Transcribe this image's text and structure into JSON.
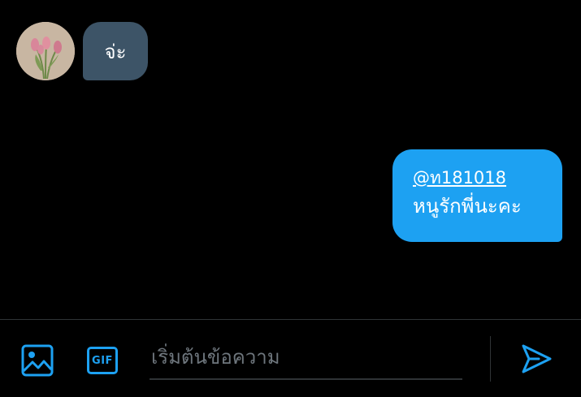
{
  "conversation": {
    "incoming": {
      "avatar_icon": "tulip-flowers-avatar",
      "text": "จ่ะ"
    },
    "outgoing": {
      "mention": "@ท181018",
      "text": "หนูรักพี่นะคะ"
    }
  },
  "composer": {
    "image_icon": "image-icon",
    "gif_label": "GIF",
    "input_value": "",
    "input_placeholder": "เริ่มต้นข้อความ",
    "send_icon": "send-icon"
  },
  "colors": {
    "background": "#000000",
    "incoming_bubble": "#3d5467",
    "outgoing_bubble": "#1da1f2",
    "accent": "#1da1f2",
    "divider": "#2f3336",
    "placeholder": "#6e767d"
  }
}
